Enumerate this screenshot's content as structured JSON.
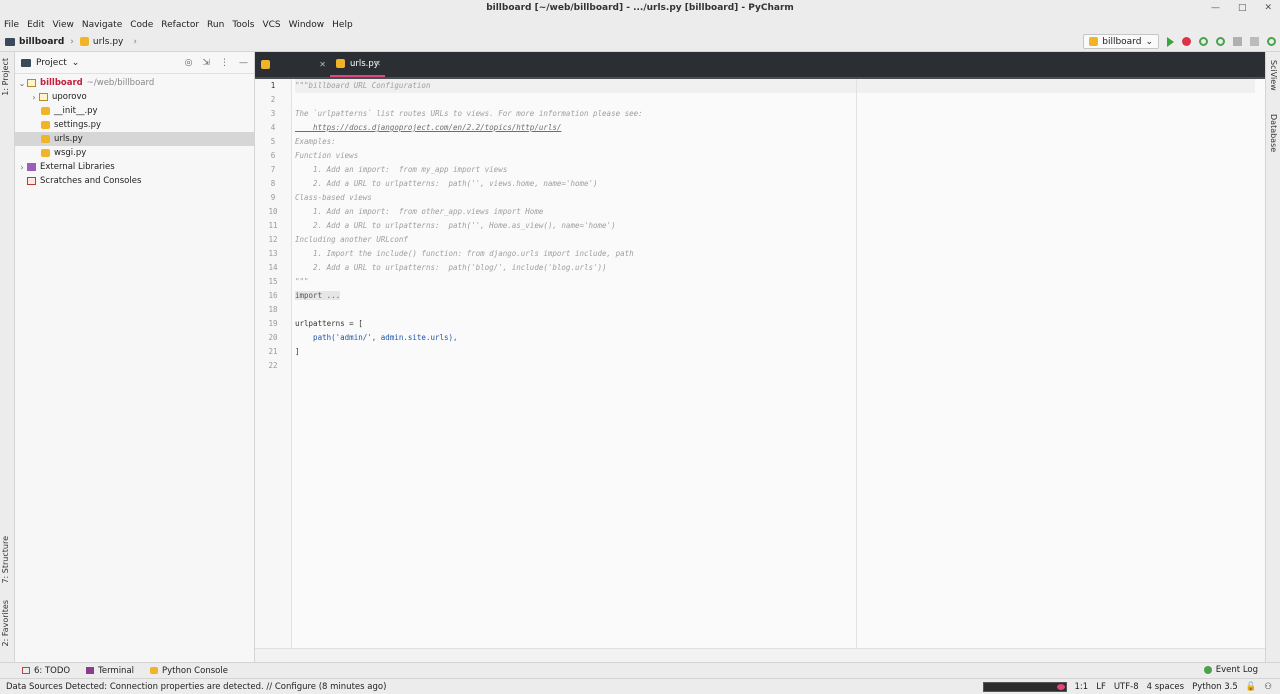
{
  "window": {
    "title": "billboard [~/web/billboard] - .../urls.py [billboard] - PyCharm"
  },
  "menu": [
    "File",
    "Edit",
    "View",
    "Navigate",
    "Code",
    "Refactor",
    "Run",
    "Tools",
    "VCS",
    "Window",
    "Help"
  ],
  "navbar": {
    "project": "billboard",
    "file": "urls.py"
  },
  "run_config": {
    "label": "billboard"
  },
  "project_panel": {
    "title": "Project",
    "root": {
      "name": "billboard",
      "path": "~/web/billboard"
    },
    "items": [
      {
        "label": "uporovo",
        "type": "folder"
      },
      {
        "label": "__init__.py",
        "type": "py"
      },
      {
        "label": "settings.py",
        "type": "py"
      },
      {
        "label": "urls.py",
        "type": "py",
        "selected": true
      },
      {
        "label": "wsgi.py",
        "type": "py"
      },
      {
        "label": "External Libraries",
        "type": "lib"
      },
      {
        "label": "Scratches and Consoles",
        "type": "scratch"
      }
    ]
  },
  "left_tabs": {
    "project": "1: Project",
    "structure": "7: Structure",
    "favorites": "2: Favorites"
  },
  "right_tabs": {
    "sciview": "SciView",
    "database": "Database"
  },
  "editor": {
    "tabs": [
      {
        "label": "",
        "active": false
      },
      {
        "label": "urls.py",
        "active": true
      }
    ],
    "lines": [
      "\"\"\"billboard URL Configuration",
      "",
      "The `urlpatterns` list routes URLs to views. For more information please see:",
      "    https://docs.djangoproject.com/en/2.2/topics/http/urls/",
      "Examples:",
      "Function views",
      "    1. Add an import:  from my_app import views",
      "    2. Add a URL to urlpatterns:  path('', views.home, name='home')",
      "Class-based views",
      "    1. Add an import:  from other_app.views import Home",
      "    2. Add a URL to urlpatterns:  path('', Home.as_view(), name='home')",
      "Including another URLconf",
      "    1. Import the include() function: from django.urls import include, path",
      "    2. Add a URL to urlpatterns:  path('blog/', include('blog.urls'))",
      "\"\"\"",
      "import ...",
      "",
      "urlpatterns = [",
      "    path('admin/', admin.site.urls),",
      "]",
      "",
      ""
    ],
    "line_numbers": [
      "1",
      "2",
      "3",
      "4",
      "5",
      "6",
      "7",
      "8",
      "9",
      "10",
      "11",
      "12",
      "13",
      "14",
      "15",
      "16",
      "18",
      "19",
      "20",
      "21",
      "22"
    ]
  },
  "tool_windows": {
    "todo": "6: TODO",
    "terminal": "Terminal",
    "python_console": "Python Console",
    "event_log": "Event Log"
  },
  "status_bar": {
    "message": "Data Sources Detected: Connection properties are detected. // Configure (8 minutes ago)",
    "position": "1:1",
    "line_sep": "LF",
    "encoding": "UTF-8",
    "indent": "4 spaces",
    "interpreter": "Python 3.5"
  }
}
